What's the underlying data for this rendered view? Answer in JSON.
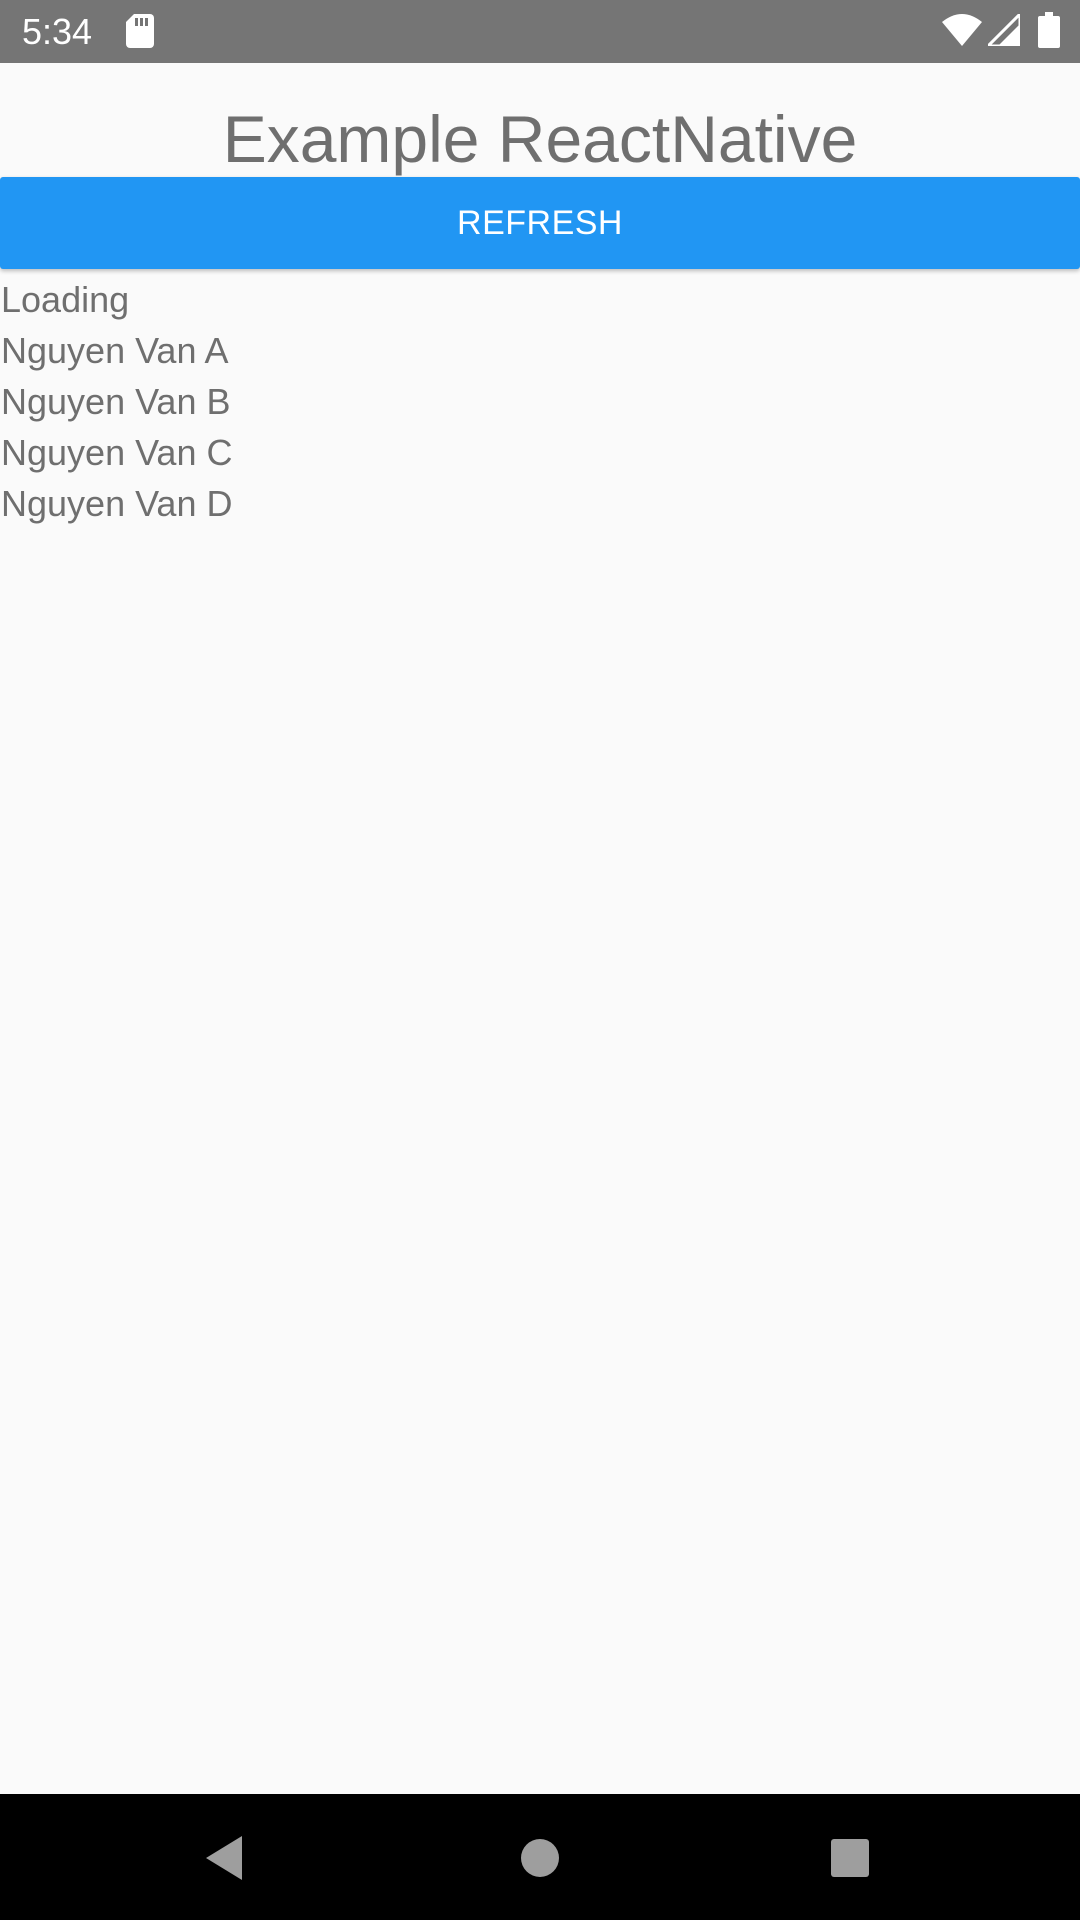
{
  "status_bar": {
    "time": "5:34",
    "icons": [
      "sd-card-icon",
      "wifi-icon",
      "cell-signal-icon",
      "battery-icon"
    ]
  },
  "app": {
    "title": "Example ReactNative",
    "refresh_label": "REFRESH",
    "items": [
      "Loading",
      "Nguyen Van A",
      "Nguyen Van B",
      "Nguyen Van C",
      "Nguyen Van D"
    ]
  },
  "nav_bar": {
    "buttons": [
      "back-icon",
      "home-icon",
      "recents-icon"
    ]
  },
  "colors": {
    "status_bar_bg": "#757575",
    "button_bg": "#2196f3",
    "text": "#6f6f6f",
    "background": "#fafafa",
    "nav_bar_bg": "#000000"
  }
}
